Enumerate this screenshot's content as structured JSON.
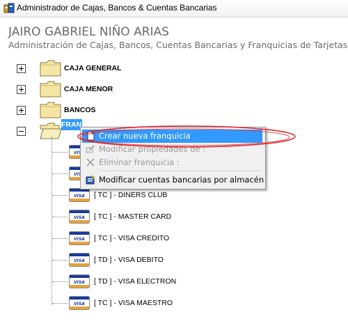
{
  "window": {
    "title": "Administrador de Cajas, Bancos & Cuentas Bancarias"
  },
  "header": {
    "user_name": "JAIRO GABRIEL NIÑO ARIAS",
    "subtitle": "Administración de Cajas, Bancos, Cuentas Bancarias y Franquicias de Tarjetas"
  },
  "tree": {
    "nodes": [
      {
        "label": "CAJA GENERAL",
        "expanded": false
      },
      {
        "label": "CAJA MENOR",
        "expanded": false
      },
      {
        "label": "BANCOS",
        "expanded": false
      },
      {
        "label": "FRAN",
        "expanded": true,
        "selected": true
      }
    ],
    "children": [
      {
        "label": ""
      },
      {
        "label": ""
      },
      {
        "label": "[ TC ] - DINERS CLUB"
      },
      {
        "label": "[ TC ] - MASTER CARD"
      },
      {
        "label": "[ TC ] - VISA CREDITO"
      },
      {
        "label": "[ TD ] - VISA DEBITO"
      },
      {
        "label": "[ TD ] - VISA ELECTRON"
      },
      {
        "label": "[ TC ] - VISA MAESTRO"
      }
    ],
    "card_icon_text": "VISA"
  },
  "context_menu": {
    "items": [
      {
        "label": "Crear nueva franquicia",
        "icon": "new-document-icon",
        "highlighted": true,
        "enabled": true
      },
      {
        "label": "Modificar propiedades de :",
        "icon": "edit-properties-icon",
        "enabled": false
      },
      {
        "label": "Eliminar franquicia :",
        "icon": "delete-x-icon",
        "enabled": false
      },
      {
        "label": "Modificar cuentas bancarias por almacén",
        "icon": "bank-accounts-icon",
        "enabled": true
      }
    ]
  },
  "colors": {
    "selection": "#3399ff",
    "annotation_ellipse": "#e0282e",
    "folder": "#f5e6a6",
    "card_blue": "#1a3a9c",
    "card_gold": "#e8a33a"
  }
}
